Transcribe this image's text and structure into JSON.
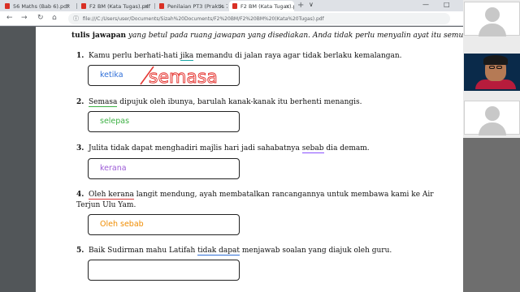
{
  "browser": {
    "tabs": [
      {
        "label": "56 Maths (Bab 6).pdf"
      },
      {
        "label": "F2 BM (Kata Tugas).pdf"
      },
      {
        "label": "Penilaian PT3 (Praktis 7).pdf"
      },
      {
        "label": "F2 BM (Kata Tugas).pdf",
        "active": true
      }
    ],
    "close_glyph": "×",
    "new_tab_glyph": "+",
    "window_controls": [
      "∨",
      "—",
      "□"
    ],
    "nav": {
      "back": "←",
      "forward": "→",
      "reload": "↻",
      "home": "⌂"
    },
    "url_info_icon": "ⓘ",
    "url": "file:///C:/Users/user/Documents/Sizah%20Documents/F2%20BM/F2%20BM%20(Kata%20Tugas).pdf"
  },
  "pdf": {
    "instruction": {
      "bold": "tulis jawapan",
      "italic": " yang betul pada ruang jawapan yang disediakan. Anda tidak perlu menyalin ayat itu semula."
    },
    "questions": [
      {
        "num": "1.",
        "before": "Kamu perlu berhati-hati ",
        "mark": "jika",
        "after": " memandu di jalan raya agar tidak berlaku kemalangan.",
        "answer": "ketika",
        "answer_color": "#2f6fd8",
        "handwriting": "semasa",
        "handwriting_color": "#e53935"
      },
      {
        "num": "2.",
        "before": "",
        "mark": "Semasa",
        "after": " dipujuk oleh ibunya, barulah kanak-kanak itu berhenti menangis.",
        "answer": "selepas",
        "answer_color": "#3cb043"
      },
      {
        "num": "3.",
        "before": "Julita tidak dapat menghadiri majlis hari jadi sahabatnya ",
        "mark": "sebab",
        "after": " dia demam.",
        "answer": "kerana",
        "answer_color": "#9c5bd6"
      },
      {
        "num": "4.",
        "before": "",
        "mark": "Oleh kerana",
        "after": " langit mendung, ayah membatalkan rancangannya untuk membawa kami ke Air Terjun Ulu Yam.",
        "answer": "Oleh sebab",
        "answer_color": "#f08c00"
      },
      {
        "num": "5.",
        "before": "Baik Sudirman mahu Latifah ",
        "mark": "tidak dapat",
        "after": " menjawab soalan yang diajuk oleh guru.",
        "answer": ""
      }
    ]
  },
  "sidebar": {
    "camera_bg": "#0a2a4a"
  }
}
